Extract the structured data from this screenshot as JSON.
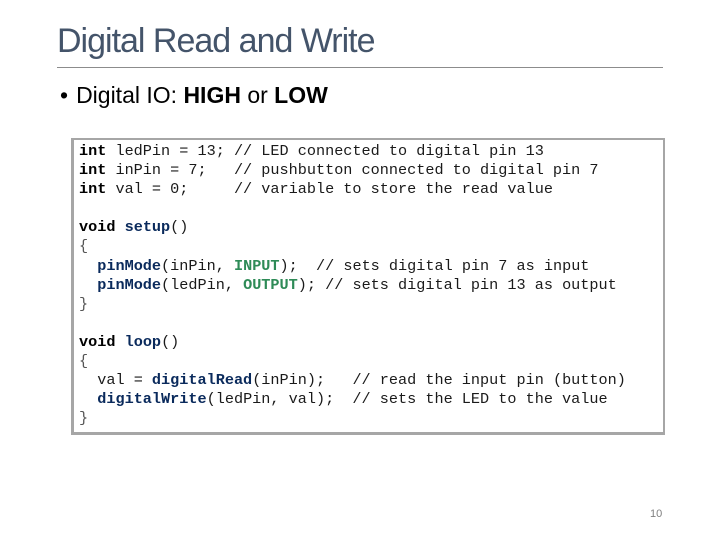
{
  "slide": {
    "title": "Digital Read and Write",
    "bullet": {
      "prefix": "Digital IO: ",
      "high": "HIGH",
      "or": " or ",
      "low": "LOW"
    },
    "page_number": "10"
  },
  "code": {
    "declarations": [
      {
        "kw": "int",
        "rest": " ledPin = 13; // LED connected to digital pin 13"
      },
      {
        "kw": "int",
        "rest": " inPin = 7;   // pushbutton connected to digital pin 7"
      },
      {
        "kw": "int",
        "rest": " val = 0;     // variable to store the read value"
      }
    ],
    "setup": {
      "kw": "void",
      "name": "setup",
      "parens": "()",
      "open": "{",
      "line1": {
        "fn": "pinMode",
        "args": "(inPin, ",
        "const": "INPUT",
        "tail": ");  // sets digital pin 7 as input"
      },
      "line2": {
        "fn": "pinMode",
        "args": "(ledPin, ",
        "const": "OUTPUT",
        "tail": "); // sets digital pin 13 as output"
      },
      "close": "}"
    },
    "loop": {
      "kw": "void",
      "name": "loop",
      "parens": "()",
      "open": "{",
      "line1": {
        "pre": "val = ",
        "fn": "digitalRead",
        "tail": "(inPin);   // read the input pin (button)"
      },
      "line2": {
        "fn": "digitalWrite",
        "tail": "(ledPin, val);  // sets the LED to the value"
      },
      "close": "}"
    }
  }
}
